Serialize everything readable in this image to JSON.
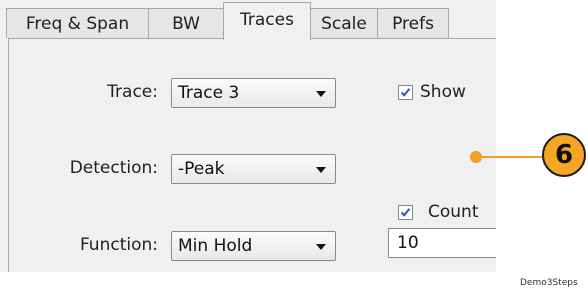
{
  "tabs": [
    {
      "label": "Freq & Span"
    },
    {
      "label": "BW"
    },
    {
      "label": "Traces"
    },
    {
      "label": "Scale"
    },
    {
      "label": "Prefs"
    }
  ],
  "form": {
    "trace_label": "Trace:",
    "trace_value": "Trace 3",
    "detection_label": "Detection:",
    "detection_value": "-Peak",
    "function_label": "Function:",
    "function_value": "Min Hold",
    "show_label": "Show",
    "show_checked": true,
    "count_label": "Count",
    "count_checked": true,
    "count_value": "10"
  },
  "callout": {
    "number": "6",
    "color": "#f5a623"
  },
  "caption": "Demo3Steps"
}
